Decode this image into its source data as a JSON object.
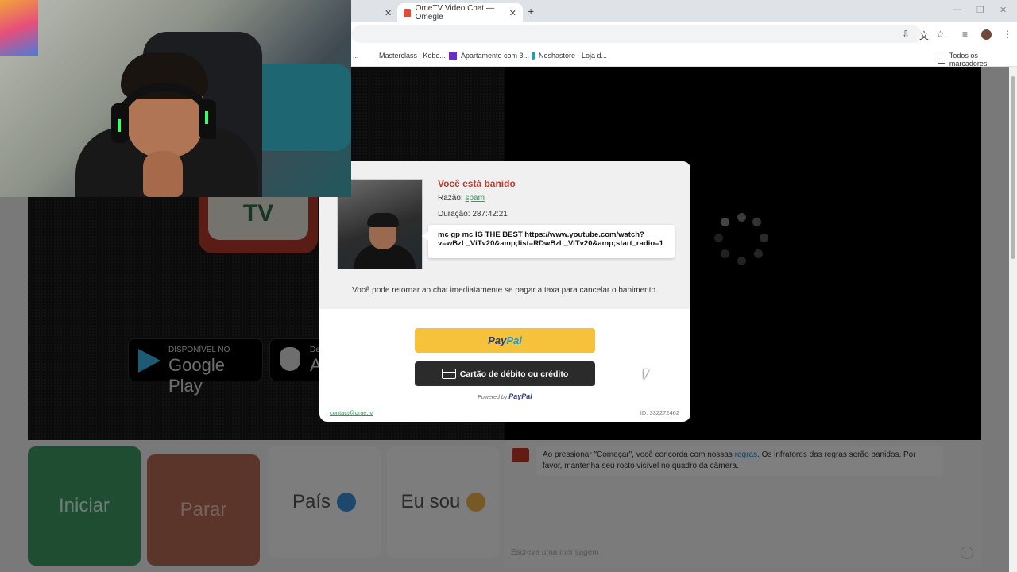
{
  "browser": {
    "tabs": [
      {
        "label": "",
        "close": "✕"
      },
      {
        "label": "OmeTV Video Chat — Omegle",
        "close": "✕"
      }
    ],
    "new_tab": "+",
    "bookmarks": [
      {
        "label": "..."
      },
      {
        "label": "Masterclass | Kobe..."
      },
      {
        "label": "Apartamento com 3..."
      },
      {
        "label": "Neshastore - Loja d..."
      }
    ],
    "all_bookmarks": "Todos os marcadores"
  },
  "page": {
    "logo_text": "TV",
    "google_play": {
      "small": "DISPONÍVEL NO",
      "big": "Google Play"
    },
    "app_store": {
      "small": "De",
      "big": "A"
    }
  },
  "controls": {
    "start": "Iniciar",
    "stop": "Parar",
    "country": "País",
    "i_am": "Eu sou"
  },
  "chat": {
    "notice_before": "Ao pressionar \"Começar\", você concorda com nossas ",
    "notice_link": "regras",
    "notice_after": ". Os infratores das regras serão banidos. Por favor, mantenha seu rosto visível no quadro da câmera.",
    "input_placeholder": "Escreva uma mensagem"
  },
  "ban": {
    "title": "Você está banido",
    "reason_label": "Razão: ",
    "reason_value": "spam",
    "duration": "Duração: 287:42:21",
    "message": "mc gp mc IG THE BEST https://www.youtube.com/watch?v=wBzL_ViTv20&amp;list=RDwBzL_ViTv20&amp;start_radio=1",
    "info": "Você pode retornar ao chat imediatamente se pagar a taxa para cancelar o banimento.",
    "paypal_a": "Pay",
    "paypal_b": "Pal",
    "card_button": "Cartão de débito ou crédito",
    "powered_by": "Powered by ",
    "powered_brand": "PayPal",
    "contact": "contact@ome.tv",
    "id": "ID: 332272462"
  }
}
